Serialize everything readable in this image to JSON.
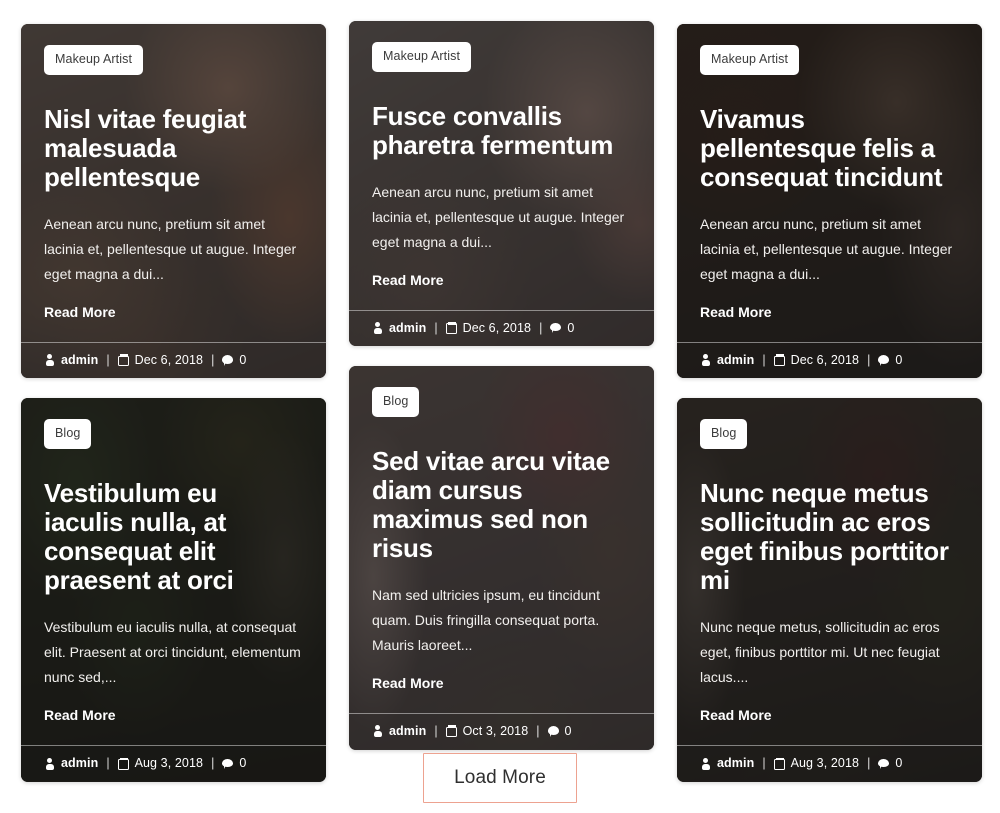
{
  "theme": {
    "page_background": "#ffffff",
    "tag_background": "#ffffff",
    "tag_text": "#3b3b3b",
    "title_text": "#ffffff",
    "button_border": "#eda290",
    "button_text": "#2f2f2f",
    "overlay": "rgba(48,45,43,0.74)"
  },
  "columns": [
    {
      "cards": [
        {
          "tag": "Makeup Artist",
          "title": "Nisl vitae feugiat malesuada pellentesque",
          "excerpt": "Aenean arcu nunc, pretium sit amet lacinia et, pellentesque ut augue. Integer eget magna a dui...",
          "read_more": "Read More",
          "author": "admin",
          "date": "Dec 6, 2018",
          "comments": "0",
          "sep1": "|",
          "sep2": "|"
        },
        {
          "tag": "Blog",
          "title": "Vestibulum eu iaculis nulla, at consequat elit praesent at orci",
          "excerpt": "Vestibulum eu iaculis nulla, at consequat elit. Praesent at orci tincidunt, elementum nunc sed,...",
          "read_more": "Read More",
          "author": "admin",
          "date": "Aug 3, 2018",
          "comments": "0",
          "sep1": "|",
          "sep2": "|"
        }
      ]
    },
    {
      "cards": [
        {
          "tag": "Makeup Artist",
          "title": "Fusce convallis pharetra fermentum",
          "excerpt": "Aenean arcu nunc, pretium sit amet lacinia et, pellentesque ut augue. Integer eget magna a dui...",
          "read_more": "Read More",
          "author": "admin",
          "date": "Dec 6, 2018",
          "comments": "0",
          "sep1": "|",
          "sep2": "|"
        },
        {
          "tag": "Blog",
          "title": "Sed vitae arcu vitae diam cursus maximus sed non risus",
          "excerpt": "Nam sed ultricies ipsum, eu tincidunt quam. Duis fringilla consequat porta. Mauris laoreet...",
          "read_more": "Read More",
          "author": "admin",
          "date": "Oct 3, 2018",
          "comments": "0",
          "sep1": "|",
          "sep2": "|"
        }
      ]
    },
    {
      "cards": [
        {
          "tag": "Makeup Artist",
          "title": "Vivamus pellentesque felis a consequat tincidunt",
          "excerpt": "Aenean arcu nunc, pretium sit amet lacinia et, pellentesque ut augue. Integer eget magna a dui...",
          "read_more": "Read More",
          "author": "admin",
          "date": "Dec 6, 2018",
          "comments": "0",
          "sep1": "|",
          "sep2": "|"
        },
        {
          "tag": "Blog",
          "title": "Nunc neque metus sollicitudin ac eros eget finibus porttitor mi",
          "excerpt": "Nunc neque metus, sollicitudin ac eros eget, finibus porttitor mi. Ut nec feugiat lacus....",
          "read_more": "Read More",
          "author": "admin",
          "date": "Aug 3, 2018",
          "comments": "0",
          "sep1": "|",
          "sep2": "|"
        }
      ]
    }
  ],
  "pagination": {
    "load_more_label": "Load More"
  },
  "icons": {
    "author": "user-icon",
    "date": "calendar-icon",
    "comments": "comment-icon"
  }
}
